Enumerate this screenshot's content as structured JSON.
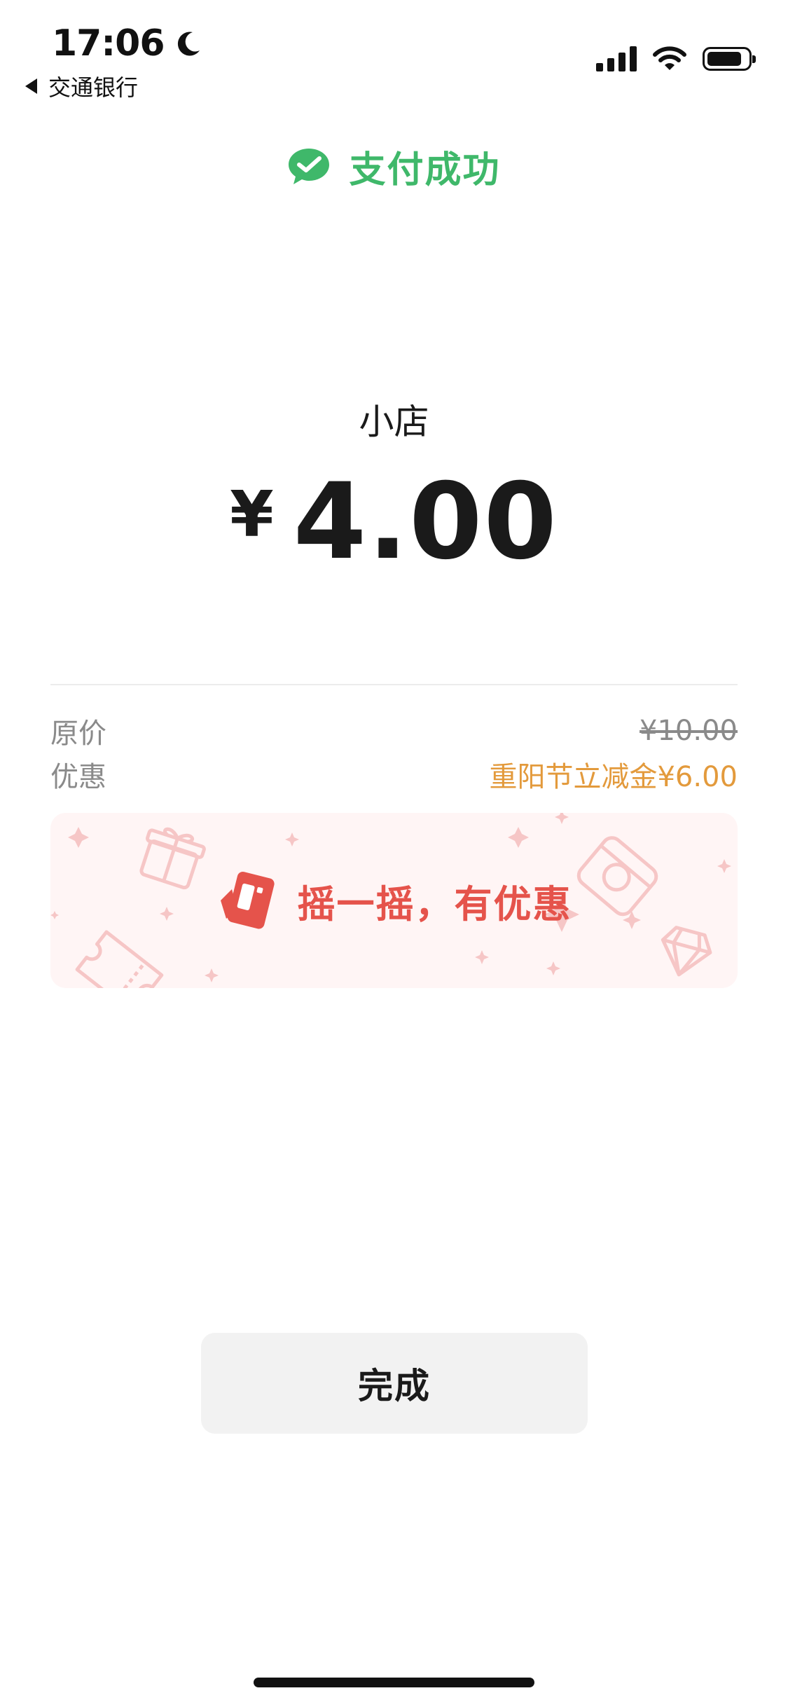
{
  "status_bar": {
    "time": "17:06",
    "back_app": "交通银行",
    "battery_level": 0.85
  },
  "header": {
    "success_text": "支付成功",
    "accent_color": "#3fb86a"
  },
  "payment": {
    "merchant": "小店",
    "currency": "¥",
    "amount": "4.00"
  },
  "details": {
    "original_label": "原价",
    "original_value": "¥10.00",
    "discount_label": "优惠",
    "discount_value": "重阳节立减金¥6.00",
    "discount_color": "#e39a3c"
  },
  "promo": {
    "text": "摇一摇，有优惠",
    "color": "#e5534b"
  },
  "actions": {
    "done_label": "完成"
  }
}
